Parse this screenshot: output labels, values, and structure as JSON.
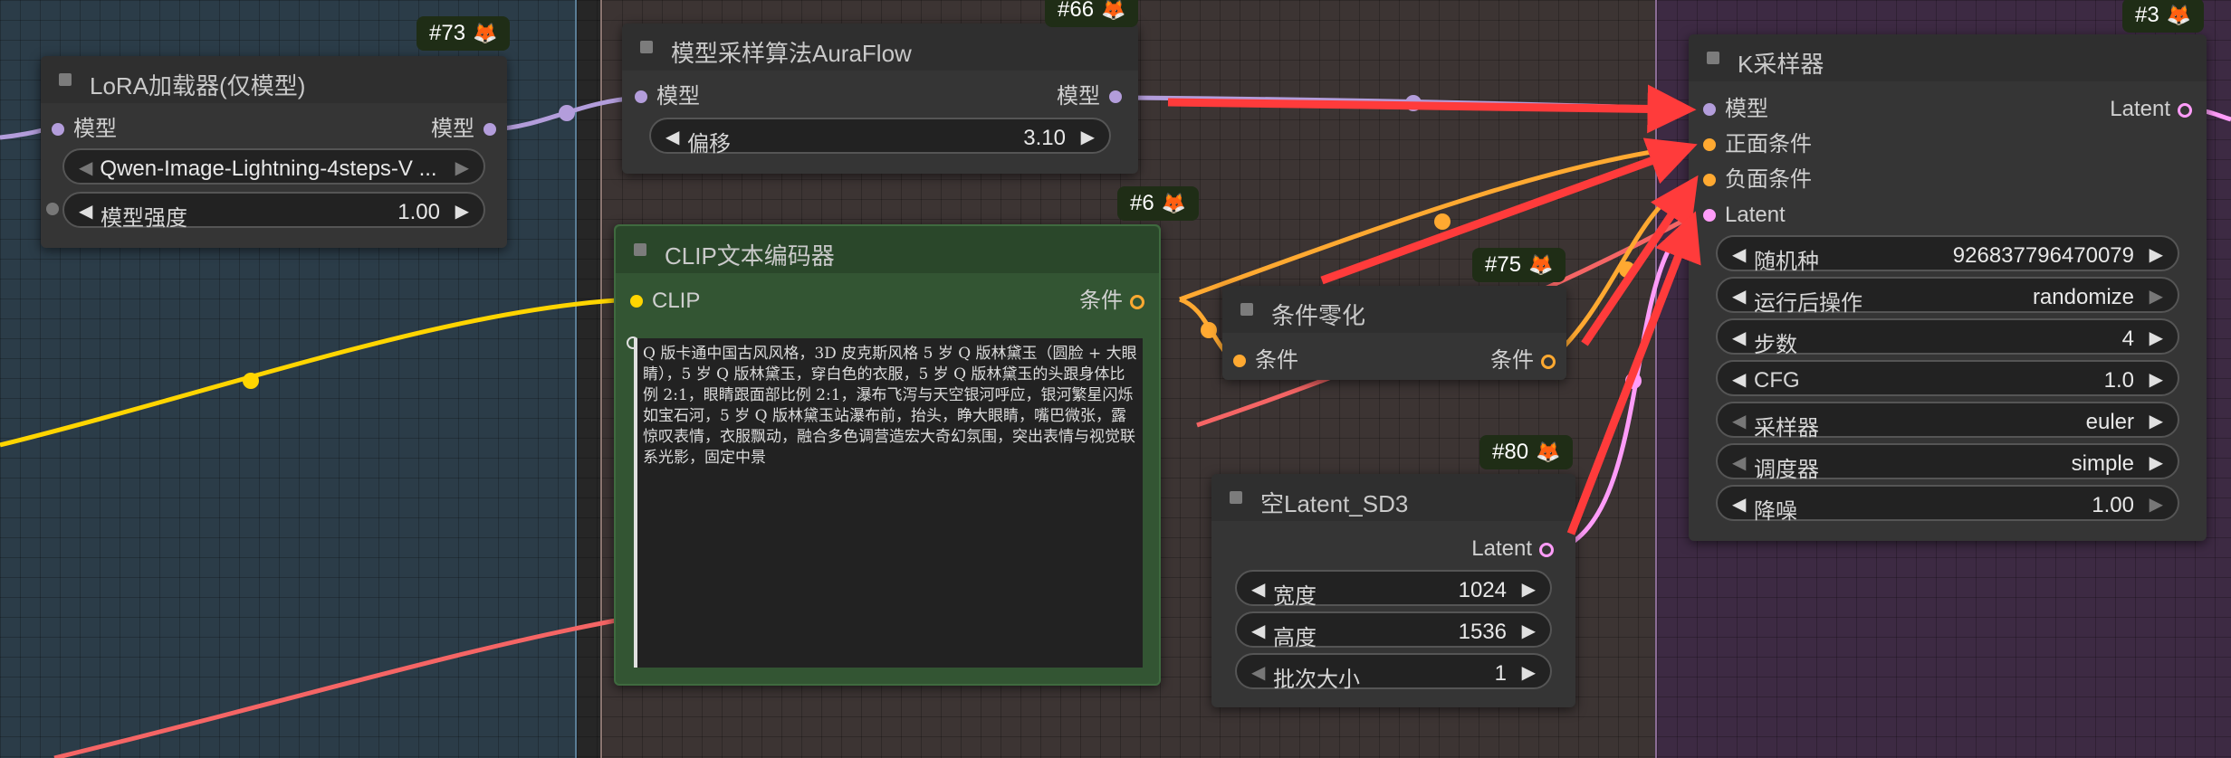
{
  "colors": {
    "model": "#b39ddb",
    "clip": "#ffd500",
    "conditioning": "#ffa931",
    "latent": "#ff9cf9",
    "red_wire": "#f56565",
    "annotation": "#ff3b3b"
  },
  "nodes": {
    "lora": {
      "badge": "#73",
      "title": "LoRA加载器(仅模型)",
      "input_model": "模型",
      "output_model": "模型",
      "lora_name": "Qwen-Image-Lightning-4steps-V ...",
      "strength_label": "模型强度",
      "strength_value": "1.00"
    },
    "auraflow": {
      "badge": "#66",
      "title": "模型采样算法AuraFlow",
      "input_model": "模型",
      "output_model": "模型",
      "shift_label": "偏移",
      "shift_value": "3.10"
    },
    "clip": {
      "badge": "#6",
      "title": "CLIP文本编码器",
      "input_clip": "CLIP",
      "output_cond": "条件",
      "prompt": "Q 版卡通中国古风风格，3D 皮克斯风格 5 岁 Q 版林黛玉（圆脸 + 大眼睛），5 岁 Q 版林黛玉，穿白色的衣服，5 岁 Q 版林黛玉的头跟身体比例 2:1，眼睛跟面部比例 2:1，瀑布飞泻与天空银河呼应，银河繁星闪烁如宝石河，5 岁 Q 版林黛玉站瀑布前，抬头，睁大眼睛，嘴巴微张，露惊叹表情，衣服飘动，融合多色调营造宏大奇幻氛围，突出表情与视觉联系光影，固定中景"
    },
    "zero": {
      "badge": "#75",
      "title": "条件零化",
      "input_cond": "条件",
      "output_cond": "条件"
    },
    "latent": {
      "badge": "#80",
      "title": "空Latent_SD3",
      "output_latent": "Latent",
      "width_label": "宽度",
      "width_value": "1024",
      "height_label": "高度",
      "height_value": "1536",
      "batch_label": "批次大小",
      "batch_value": "1"
    },
    "ksampler": {
      "badge": "#3",
      "title": "K采样器",
      "input_model": "模型",
      "input_positive": "正面条件",
      "input_negative": "负面条件",
      "input_latent": "Latent",
      "output_latent": "Latent",
      "seed_label": "随机种",
      "seed_value": "926837796470079",
      "control_label": "运行后操作",
      "control_value": "randomize",
      "steps_label": "步数",
      "steps_value": "4",
      "cfg_label": "CFG",
      "cfg_value": "1.0",
      "sampler_label": "采样器",
      "sampler_value": "euler",
      "scheduler_label": "调度器",
      "scheduler_value": "simple",
      "denoise_label": "降噪",
      "denoise_value": "1.00"
    }
  }
}
